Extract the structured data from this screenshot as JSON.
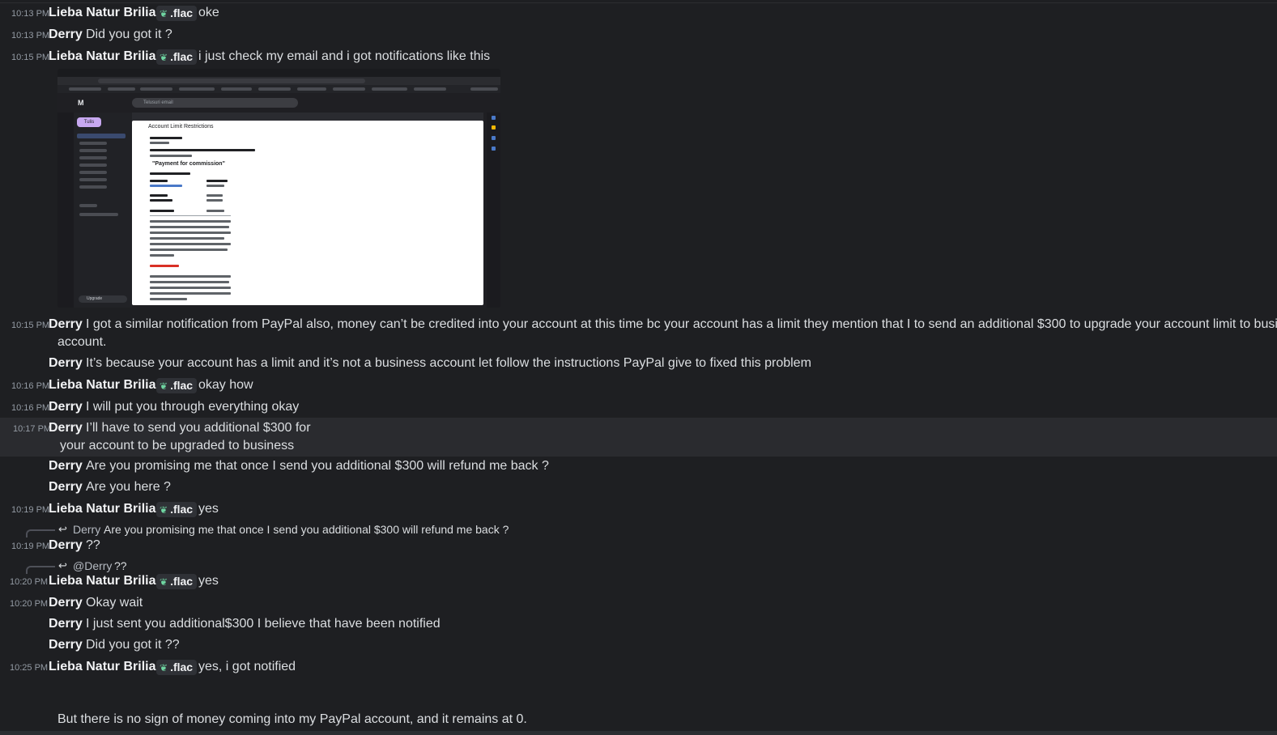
{
  "users": {
    "lieba": "Lieba Natur Brilian",
    "derry": "Derry",
    "tag": ".flac"
  },
  "messages": [
    {
      "time": "10:13 PM",
      "author": "Lieba Natur Brilian",
      "text": "oke"
    },
    {
      "time": "10:13 PM",
      "author": "Derry",
      "text": "Did you got it ?"
    },
    {
      "time": "10:15 PM",
      "author": "Lieba Natur Brilian",
      "text": "i just check my email and i got notifications like this"
    },
    {
      "time": "10:15 PM",
      "author": "Derry",
      "text": "I got a similar notification from PayPal also, money can’t be credited into your account at this time bc your account has a limit they mention that I to send an additional $300 to upgrade your account limit to business",
      "text_cont": "account."
    },
    {
      "time": "",
      "author": "Derry",
      "text": "It’s because your account has a limit and it’s not a business account let follow the instructions PayPal give to fixed this problem"
    },
    {
      "time": "10:16 PM",
      "author": "Lieba Natur Brilian",
      "text": "okay how"
    },
    {
      "time": "10:16 PM",
      "author": "Derry",
      "text": "I will put you through everything okay"
    },
    {
      "time": "10:17 PM",
      "author": "Derry",
      "text": "I’ll have to send you additional $300 for",
      "text_cont": "your account to be upgraded to business"
    },
    {
      "time": "",
      "author": "Derry",
      "text": "Are you promising me that once I send you additional $300 will refund me back ?"
    },
    {
      "time": "",
      "author": "Derry",
      "text": "Are you here ?"
    },
    {
      "time": "10:19 PM",
      "author": "Lieba Natur Brilian",
      "text": "yes"
    },
    {
      "time": "10:19 PM",
      "author": "Derry",
      "text": "??",
      "reply_to": {
        "author": "Derry",
        "text": "Are you promising me that once I send you additional $300 will refund me back ?"
      }
    },
    {
      "time": "10:20 PM",
      "author": "Lieba Natur Brilian",
      "text": "yes",
      "reply_to": {
        "author": "@Derry",
        "text": "??"
      }
    },
    {
      "time": "10:20 PM",
      "author": "Derry",
      "text": "Okay wait"
    },
    {
      "time": "",
      "author": "Derry",
      "text": "I just sent you additional$300 I believe that have been notified"
    },
    {
      "time": "",
      "author": "Derry",
      "text": "Did you got it ??"
    },
    {
      "time": "10:25 PM",
      "author": "Lieba Natur Brilian",
      "text": "yes, i got notified"
    }
  ],
  "attachment": {
    "search_placeholder": "Telusuri email",
    "gmail_logo": "M",
    "compose": "Tulis",
    "upgrade": "Upgrade",
    "subject": "Account Limit Restrictions",
    "heading": "\"Payment for commission\"",
    "received": "You Received a payment of 500.00 USD from Domian Castro"
  },
  "draft_text": "But there is no sign of money coming into my PayPal account, and it remains at 0.",
  "colors": {
    "background": "#1e1f22",
    "highlight_row": "#2a2b2f",
    "tag_leaf": "#6fd6a2"
  }
}
